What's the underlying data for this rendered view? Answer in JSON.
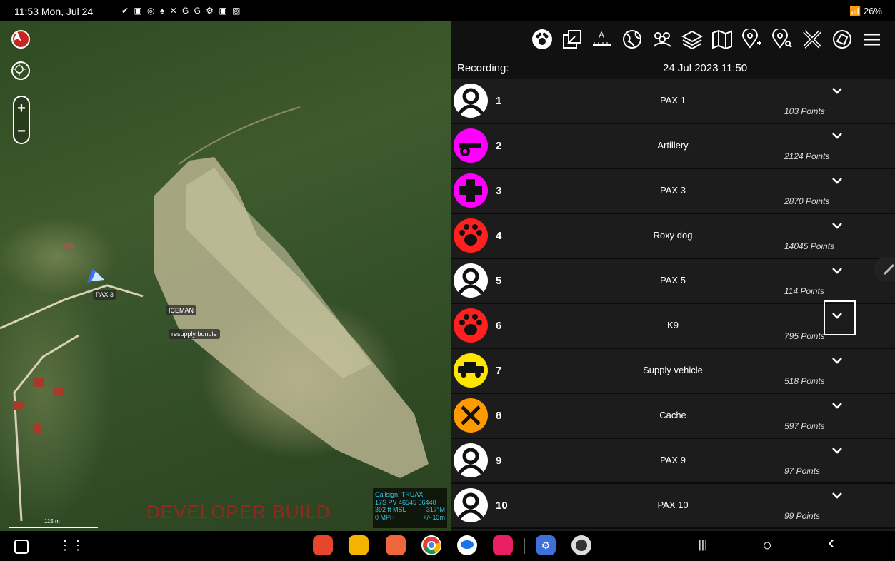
{
  "status_bar": {
    "time": "11:53  Mon, Jul 24",
    "notification_icons": "✔ ▣ ◎ ♠ ✕ G G ⚙ ▣ ▨",
    "right_status": "26%"
  },
  "map": {
    "labels": {
      "pax": "PAX 3",
      "iceman": "ICEMAN",
      "bundle": "resupply bundle"
    },
    "developer_text": "DEVELOPER BUILD",
    "scale_label": "115 m",
    "callsign_info": {
      "line1": "Callsign: TRUAX",
      "line2a": "17S PV 46545 06440",
      "line3a": "392 ft MSL",
      "line3b": "317°M",
      "line4a": "0 MPH",
      "line4b": "+/- 13m"
    }
  },
  "toolbar_icons": [
    "paw-icon",
    "export-icon",
    "measure-icon",
    "globe-icon",
    "group-icon",
    "layers-icon",
    "map-icon",
    "add-marker-icon",
    "search-marker-icon",
    "tools-icon",
    "alert-icon",
    "menu-icon"
  ],
  "recording": {
    "label": "Recording:",
    "datetime": "24 Jul 2023 11:50"
  },
  "tracks": [
    {
      "num": "1",
      "name": "PAX 1",
      "points": "103 Points",
      "icon": "person-icon",
      "color": "#ffffff"
    },
    {
      "num": "2",
      "name": "Artillery",
      "points": "2124 Points",
      "icon": "cannon-icon",
      "color": "#ff00ff"
    },
    {
      "num": "3",
      "name": "PAX 3",
      "points": "2870 Points",
      "icon": "medical-cross-icon",
      "color": "#ff00ff"
    },
    {
      "num": "4",
      "name": "Roxy dog",
      "points": "14045 Points",
      "icon": "paw-icon",
      "color": "#ff2020"
    },
    {
      "num": "5",
      "name": "PAX 5",
      "points": "114 Points",
      "icon": "person-icon",
      "color": "#ffffff"
    },
    {
      "num": "6",
      "name": "K9",
      "points": "795 Points",
      "icon": "paw-icon",
      "color": "#ff2020"
    },
    {
      "num": "7",
      "name": "Supply vehicle",
      "points": "518 Points",
      "icon": "vehicle-icon",
      "color": "#ffe600"
    },
    {
      "num": "8",
      "name": "Cache",
      "points": "597 Points",
      "icon": "tools-icon",
      "color": "#ff9a00"
    },
    {
      "num": "9",
      "name": "PAX 9",
      "points": "97 Points",
      "icon": "person-icon",
      "color": "#ffffff"
    },
    {
      "num": "10",
      "name": "PAX 10",
      "points": "99 Points",
      "icon": "person-icon",
      "color": "#ffffff"
    }
  ],
  "nav_bar": {
    "recent_glyph": "|||",
    "home_glyph": "○",
    "back_glyph": "‹"
  }
}
